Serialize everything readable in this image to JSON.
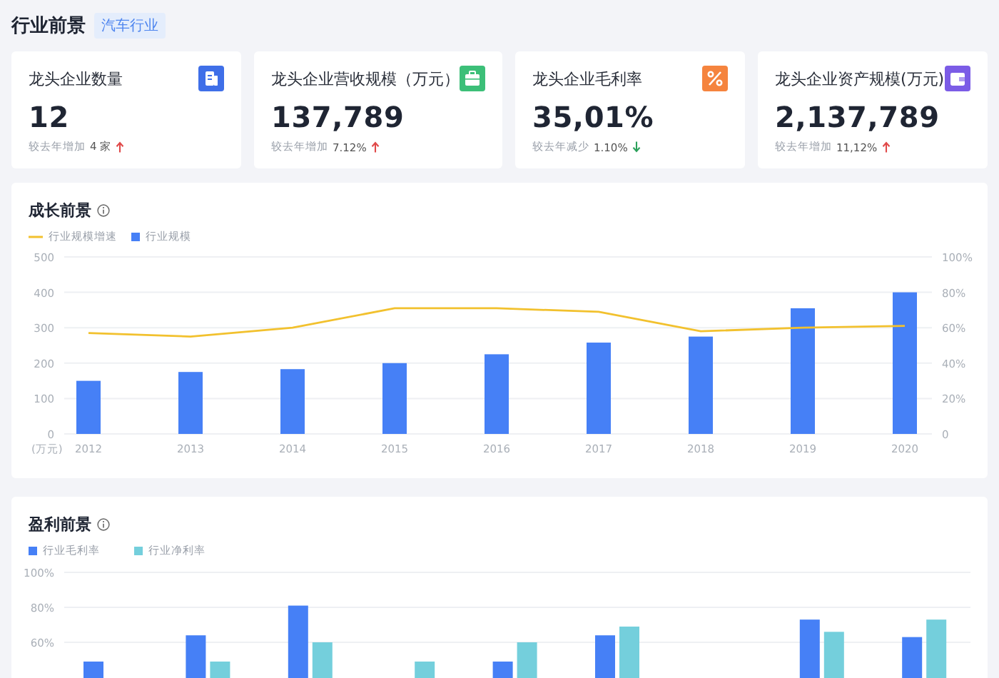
{
  "header": {
    "title": "行业前景",
    "tag": "汽车行业"
  },
  "cards": [
    {
      "label": "龙头企业数量",
      "value": "12",
      "change_label": "较去年增加",
      "change_value": "4 家",
      "up": true,
      "kind": "document",
      "color": "#3f6fe8"
    },
    {
      "label": "龙头企业营收规模（万元）",
      "value": "137,789",
      "change_label": "较去年增加",
      "change_value": "7.12%",
      "up": true,
      "kind": "briefcase",
      "color": "#3cbf78"
    },
    {
      "label": "龙头企业毛利率",
      "value": "35,01%",
      "change_label": "较去年减少",
      "change_value": "1.10%",
      "up": false,
      "kind": "percent",
      "color": "#f5843e"
    },
    {
      "label": "龙头企业资产规模(万元)",
      "value": "2,137,789",
      "change_label": "较去年增加",
      "change_value": "11,12%",
      "up": true,
      "kind": "wallet",
      "color": "#7b5ce6"
    }
  ],
  "growth": {
    "title": "成长前景",
    "chart_data": {
      "type": "bar",
      "ylabel": "(万元)",
      "categories": [
        "2012",
        "2013",
        "2014",
        "2015",
        "2016",
        "2017",
        "2018",
        "2019",
        "2020"
      ],
      "series": [
        {
          "name": "行业规模增速",
          "color": "#f2c12e",
          "type": "line",
          "axis": "y2",
          "values": [
            57,
            55,
            60,
            71,
            71,
            69,
            58,
            60,
            61
          ]
        },
        {
          "name": "行业规模",
          "color": "#4680f6",
          "type": "bar",
          "values": [
            150,
            175,
            183,
            200,
            225,
            258,
            275,
            355,
            400
          ]
        }
      ],
      "grid": true,
      "ylim": [
        0,
        500
      ],
      "yticks": [
        0,
        100,
        200,
        300,
        400,
        500
      ],
      "y2lim": [
        0,
        100
      ],
      "y2ticks": [
        {
          "value": 0,
          "label": "0"
        },
        {
          "value": 20,
          "label": "20%"
        },
        {
          "value": 40,
          "label": "40%"
        },
        {
          "value": 60,
          "label": "60%"
        },
        {
          "value": 80,
          "label": "80%"
        },
        {
          "value": 100,
          "label": "100%"
        }
      ]
    }
  },
  "profit": {
    "title": "盈利前景",
    "chart_data": {
      "type": "bar",
      "series": [
        {
          "name": "行业毛利率",
          "color": "#4680f6",
          "values": [
            49,
            64,
            81,
            null,
            49,
            64,
            null,
            73,
            63
          ]
        },
        {
          "name": "行业净利率",
          "color": "#74cfdc",
          "values": [
            null,
            49,
            60,
            49,
            60,
            69,
            null,
            66,
            73
          ]
        }
      ],
      "grid": true,
      "ylim": [
        0,
        100
      ],
      "yticks": [
        {
          "value": 60,
          "label": "60%"
        },
        {
          "value": 80,
          "label": "80%"
        },
        {
          "value": 100,
          "label": "100%"
        }
      ]
    }
  }
}
